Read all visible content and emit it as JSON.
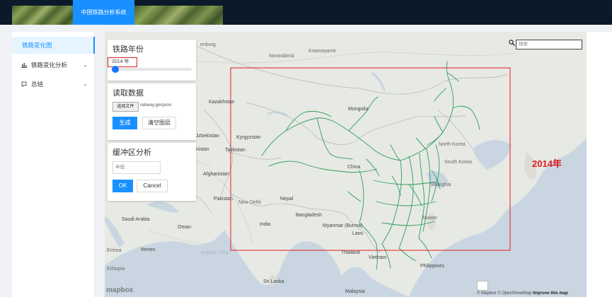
{
  "header": {
    "title": "中国铁路分析系统"
  },
  "sidebar": {
    "items": [
      {
        "label": "铁路变化图",
        "icon": ""
      },
      {
        "label": "铁路变化分析",
        "icon": "bar-chart-icon"
      },
      {
        "label": "总结",
        "icon": "comment-icon"
      }
    ]
  },
  "panels": {
    "year": {
      "title": "铁路年份",
      "value": "2014 年"
    },
    "data": {
      "title": "读取数据",
      "file_button": "选择文件",
      "file_name": "railway.geojson",
      "generate_label": "生成",
      "clear_label": "清空图层"
    },
    "buffer": {
      "title": "缓冲区分析",
      "radius_placeholder": "半径:",
      "ok_label": "OK",
      "cancel_label": "Cancel"
    }
  },
  "search": {
    "placeholder": "搜索"
  },
  "annotation": {
    "year_label": "2014年"
  },
  "map": {
    "labels": {
      "orenburg": "enburg",
      "novosibirsk": "Novosibirsk",
      "krasnoyarsk": "Krasnoyarsk",
      "kazakhstan": "Kazakhstan",
      "mongolia": "Mongolia",
      "uzbekistan": "Jzbekistan",
      "kyrgyzstan": "Kyrgyzstan",
      "tajikistan": "Tajikistan",
      "turkmenistan": "nistan",
      "north_korea": "North Korea",
      "south_korea": "South Korea",
      "afghanistan": "Afghanistan",
      "china": "China",
      "shanghai": "Shanghai",
      "pakistan": "Pakistan",
      "new_delhi": "New Delhi",
      "nepal": "Nepal",
      "bangladesh": "Bangladesh",
      "taiwan": "Taiwan",
      "saudi_arabia": "Saudi Arabia",
      "oman": "Oman",
      "india": "India",
      "myanmar": "Myanmar (Burma)",
      "laos": "Laos",
      "arabian_sea": "Arabian Sea",
      "eritrea": "Eritrea",
      "yemen": "Yemen",
      "thailand": "Thailand",
      "vietnam": "Vietnam",
      "philippines": "Philippines",
      "sri_lanka": "Sri Lanka",
      "malaysia": "Malaysia",
      "ethiopia": "Ethiopia"
    },
    "logo": "mapbox",
    "attribution_prefix": "© Mapbox © OpenStreetMap ",
    "attribution_link": "Improve this map"
  },
  "colors": {
    "accent": "#1890ff",
    "railway": "#2e9e5b",
    "highlight": "#e02020",
    "header_bg": "#0b1a2a"
  }
}
